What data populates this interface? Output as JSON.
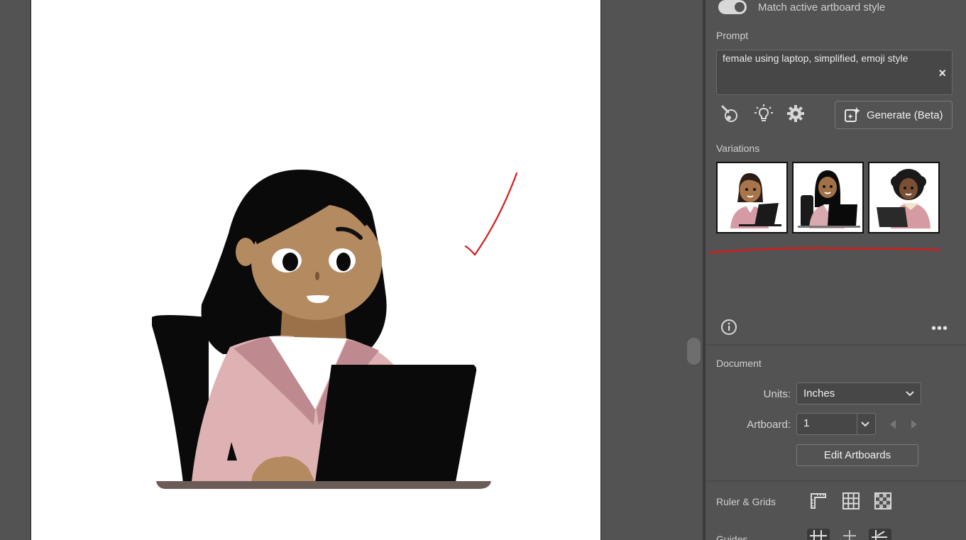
{
  "panel": {
    "match_style_label": "Match active artboard style",
    "prompt_label": "Prompt",
    "prompt_value": "female using laptop, simplified, emoji style",
    "clear_icon": "×",
    "generate_label": "Generate (Beta)",
    "variations_label": "Variations",
    "more_icon": "•••"
  },
  "document": {
    "section_label": "Document",
    "units_label": "Units:",
    "units_value": "Inches",
    "artboard_label": "Artboard:",
    "artboard_value": "1",
    "edit_artboards_label": "Edit Artboards"
  },
  "rulers": {
    "label": "Ruler & Grids",
    "guides_label": "Guides"
  },
  "colors": {
    "panel_bg": "#535353",
    "annotation_red": "#d61a1a",
    "hair": "#0a0a0a",
    "skin": "#b48a60",
    "sweater": "#deb2b2"
  }
}
